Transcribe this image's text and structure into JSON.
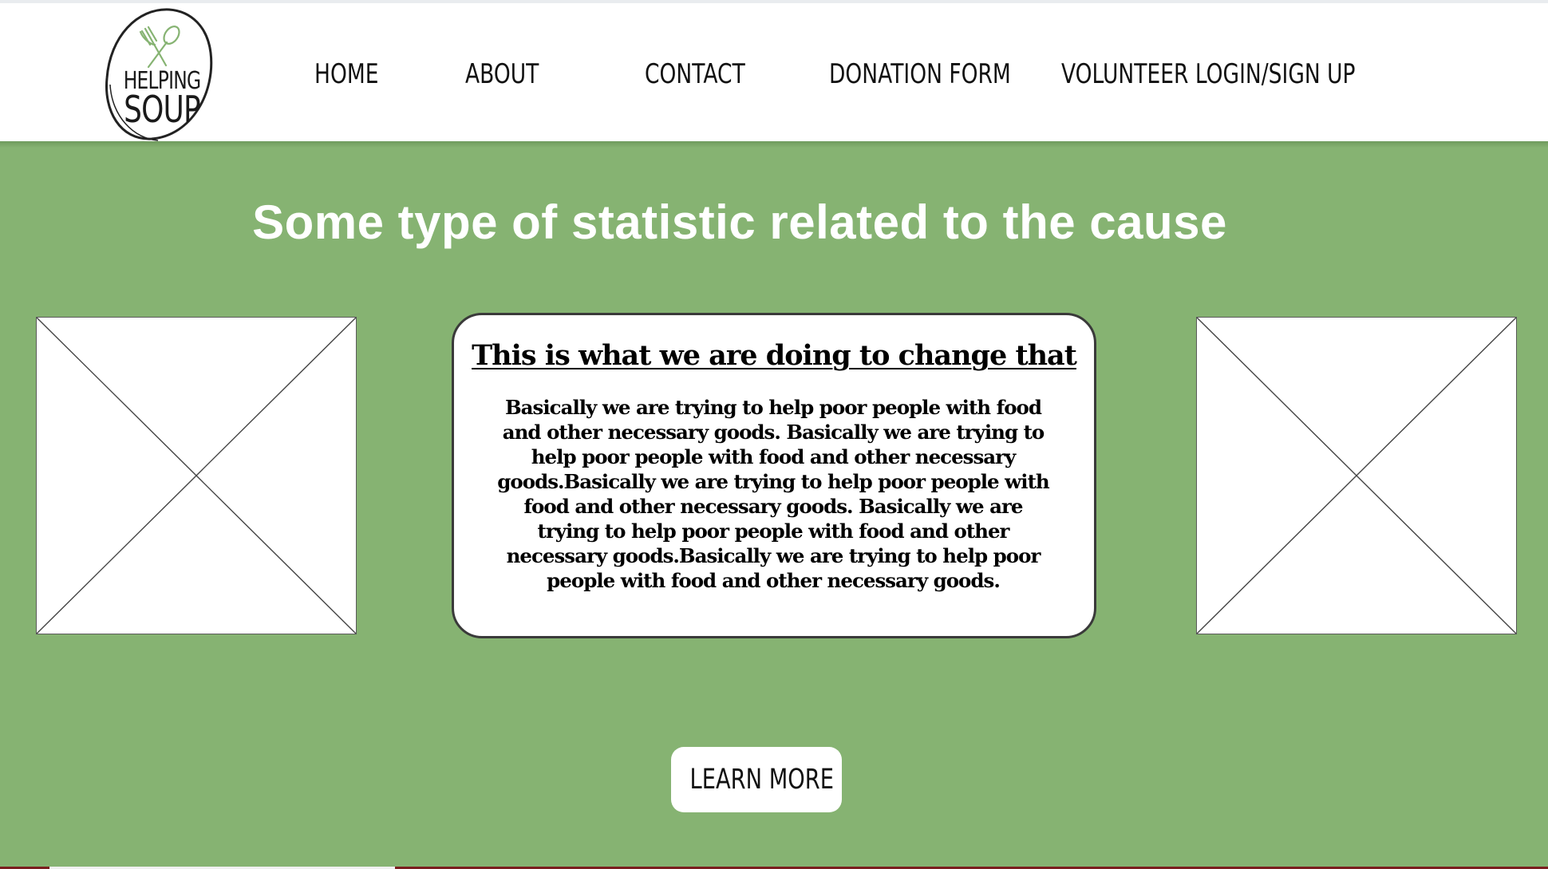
{
  "logo": {
    "line1": "HELPING",
    "line2": "SOUP",
    "icon": "fork-spoon-icon",
    "accent_color": "#86b372"
  },
  "nav": {
    "items": [
      {
        "label": "HOME"
      },
      {
        "label": "ABOUT"
      },
      {
        "label": "CONTACT"
      },
      {
        "label": "DONATION FORM"
      },
      {
        "label": "VOLUNTEER LOGIN/SIGN UP"
      }
    ]
  },
  "hero": {
    "title": "Some type of statistic related to the cause",
    "background_color": "#86b372"
  },
  "card": {
    "title": "This is what we are doing to change that",
    "body": "Basically we are trying to help poor people with food and other necessary goods. Basically we are trying to help poor people with food and other necessary goods.Basically we are trying to help poor people with food and other necessary goods. Basically we are trying to help poor people with food and other necessary goods.Basically we are trying to help poor people with food and other necessary goods."
  },
  "images": [
    {
      "icon": "image-placeholder-icon"
    },
    {
      "icon": "image-placeholder-icon"
    }
  ],
  "cta": {
    "label": "LEARN MORE"
  }
}
